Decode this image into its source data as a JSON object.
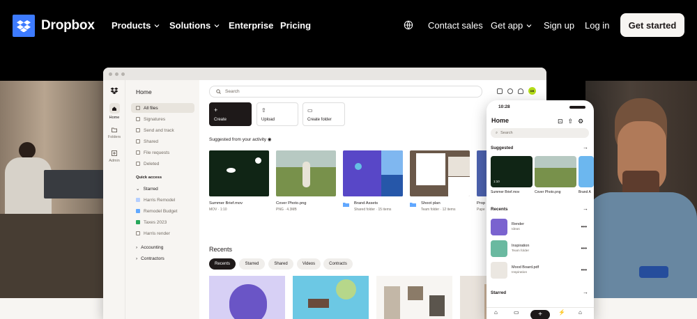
{
  "brand": {
    "name": "Dropbox",
    "logo_color": "#3d7bff",
    "icon": "dropbox-logo-icon"
  },
  "nav": {
    "items": [
      {
        "label": "Products",
        "dropdown": true
      },
      {
        "label": "Solutions",
        "dropdown": true
      },
      {
        "label": "Enterprise",
        "dropdown": false
      },
      {
        "label": "Pricing",
        "dropdown": false
      }
    ],
    "right": [
      {
        "label": "Contact sales"
      },
      {
        "label": "Get app",
        "dropdown": true
      },
      {
        "label": "Sign up"
      },
      {
        "label": "Log in"
      }
    ],
    "language_icon": "globe-icon",
    "cta": "Get started"
  },
  "desktop_app": {
    "rail": [
      {
        "label": "Home",
        "icon": "home-icon"
      },
      {
        "label": "Folders",
        "icon": "folder-icon"
      },
      {
        "label": "Admin",
        "icon": "admin-icon"
      }
    ],
    "sidebar": {
      "title": "Home",
      "items": [
        {
          "label": "All files",
          "active": true
        },
        {
          "label": "Signatures"
        },
        {
          "label": "Send and track"
        },
        {
          "label": "Shared"
        },
        {
          "label": "File requests"
        },
        {
          "label": "Deleted"
        }
      ],
      "quick_access": "Quick access",
      "starred_label": "Starred",
      "starred": [
        {
          "label": "Harris Remodel"
        },
        {
          "label": "Remodel Budget"
        },
        {
          "label": "Taxes 2023"
        },
        {
          "label": "Harris render"
        }
      ],
      "groups": [
        {
          "label": "Accounting"
        },
        {
          "label": "Contractors"
        }
      ]
    },
    "search_placeholder": "Search",
    "avatar_initials": "DB",
    "actions": [
      {
        "label": "Create",
        "icon": "plus-icon"
      },
      {
        "label": "Upload",
        "icon": "upload-icon"
      },
      {
        "label": "Create folder",
        "icon": "folder-plus-icon"
      }
    ],
    "suggested_label": "Suggested from your activity",
    "suggested": [
      {
        "title": "Summer Brief.mov",
        "meta": "MOV · 1:10"
      },
      {
        "title": "Cover Photo.png",
        "meta": "PNG · 4.3MB"
      },
      {
        "title": "Brand Assets",
        "meta": "Shared folder · 15 items"
      },
      {
        "title": "Shoot plan",
        "meta": "Team folder · 12 items"
      },
      {
        "title": "Prop",
        "meta": "Pape"
      }
    ],
    "recents_title": "Recents",
    "filters": [
      {
        "label": "Recents",
        "active": true
      },
      {
        "label": "Starred"
      },
      {
        "label": "Shared"
      },
      {
        "label": "Videos"
      },
      {
        "label": "Contracts"
      }
    ]
  },
  "phone": {
    "time": "10:28",
    "title": "Home",
    "search_placeholder": "Search",
    "suggested_label": "Suggested",
    "suggested": [
      {
        "title": "Summer Brief.mov",
        "badge": "1:10"
      },
      {
        "title": "Cover Photo.png"
      },
      {
        "title": "Brand A"
      }
    ],
    "recents_label": "Recents",
    "recents": [
      {
        "name": "Render",
        "meta": "Ideas"
      },
      {
        "name": "Inspiration",
        "meta": "Team folder"
      },
      {
        "name": "Mood Board.pdf",
        "meta": "Inspiration"
      }
    ],
    "starred_label": "Starred"
  }
}
